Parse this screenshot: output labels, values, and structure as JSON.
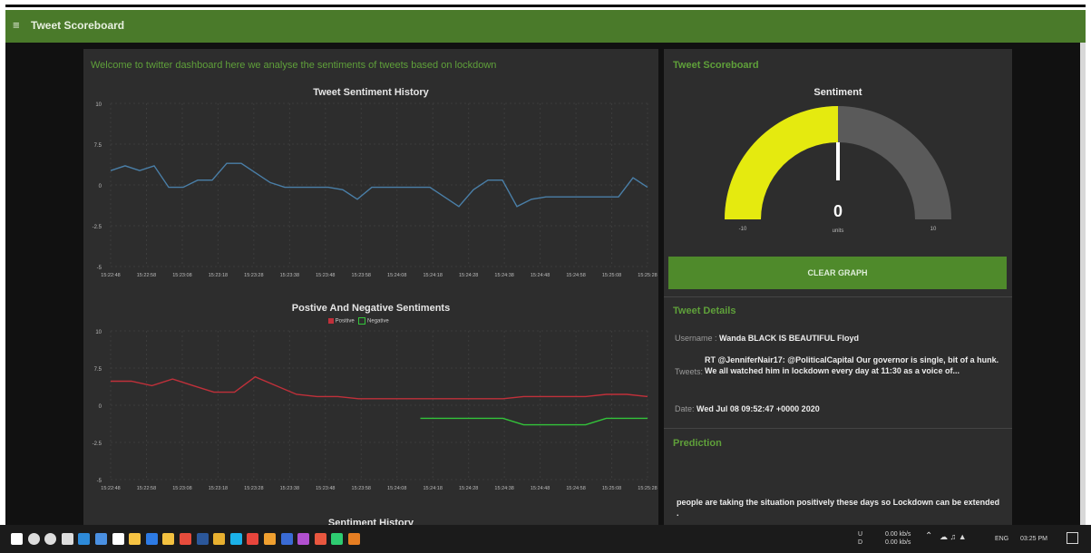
{
  "header": {
    "title": "Tweet Scoreboard",
    "menu_icon": "hamburger-icon"
  },
  "colors": {
    "accent": "#5fa03a",
    "header": "#4a7a2a",
    "button": "#4f8a2b",
    "gauge_fill": "#e5ea0f",
    "gauge_bg": "#5a5a5a",
    "history_line": "#4a7fa8",
    "positive": "#c0303a",
    "negative": "#33c43a"
  },
  "welcome": "Welcome to twitter dashboard here we analyse the sentiments of tweets based on lockdown",
  "history_chart": {
    "type": "line",
    "title": "Tweet Sentiment History",
    "y_ticks": [
      "10",
      "7.5",
      "0",
      "-2.5",
      "-5"
    ],
    "x_ticks": [
      "15:22:48",
      "15:22:58",
      "15:23:08",
      "15:23:18",
      "15:23:28",
      "15:23:38",
      "15:23:48",
      "15:23:58",
      "15:24:08",
      "15:24:18",
      "15:24:28",
      "15:24:38",
      "15:24:48",
      "15:24:58",
      "15:25:08",
      "15:25:28"
    ]
  },
  "posneg_chart": {
    "type": "line",
    "title": "Postive And Negative Sentiments",
    "legend": {
      "positive": "Positive",
      "negative": "Negative"
    },
    "y_ticks": [
      "10",
      "7.5",
      "0",
      "-2.5",
      "-5"
    ],
    "x_ticks": [
      "15:22:48",
      "15:22:58",
      "15:23:08",
      "15:23:18",
      "15:23:28",
      "15:23:38",
      "15:23:48",
      "15:23:58",
      "15:24:08",
      "15:24:18",
      "15:24:28",
      "15:24:38",
      "15:24:48",
      "15:24:58",
      "15:25:08",
      "15:25:28"
    ]
  },
  "history_title_3": "Sentiment History",
  "chart_data": [
    {
      "type": "line",
      "title": "Tweet Sentiment History",
      "ylim": [
        -5,
        10
      ],
      "x": [
        "15:22:48",
        "15:22:52",
        "15:22:56",
        "15:23:00",
        "15:23:04",
        "15:23:08",
        "15:23:12",
        "15:23:16",
        "15:23:20",
        "15:23:24",
        "15:23:28",
        "15:23:32",
        "15:23:36",
        "15:23:40",
        "15:23:44",
        "15:23:48",
        "15:23:52",
        "15:23:56",
        "15:24:00",
        "15:24:04",
        "15:24:08",
        "15:24:12",
        "15:24:16",
        "15:24:20",
        "15:24:24",
        "15:24:28",
        "15:24:32",
        "15:24:36",
        "15:24:40",
        "15:24:44",
        "15:24:48",
        "15:24:52",
        "15:24:56",
        "15:25:00",
        "15:25:04",
        "15:25:08",
        "15:25:16",
        "15:25:28"
      ],
      "series": [
        {
          "values": [
            0.6,
            0.8,
            0.6,
            0.8,
            -0.1,
            -0.1,
            0.2,
            0.2,
            0.9,
            0.9,
            0.5,
            0.1,
            -0.1,
            -0.1,
            -0.1,
            -0.1,
            -0.2,
            -0.6,
            -0.1,
            -0.1,
            -0.1,
            -0.1,
            -0.1,
            -0.5,
            -0.9,
            -0.2,
            0.2,
            0.2,
            -0.9,
            -0.6,
            -0.5,
            -0.5,
            -0.5,
            -0.5,
            -0.5,
            -0.5,
            0.3,
            -0.1
          ]
        }
      ]
    },
    {
      "type": "line",
      "title": "Postive And Negative Sentiments",
      "ylim": [
        -5,
        10
      ],
      "x": [
        "15:22:48",
        "15:22:54",
        "15:23:00",
        "15:23:06",
        "15:23:12",
        "15:23:18",
        "15:23:24",
        "15:23:30",
        "15:23:36",
        "15:23:42",
        "15:23:48",
        "15:23:54",
        "15:24:00",
        "15:24:06",
        "15:24:12",
        "15:24:18",
        "15:24:24",
        "15:24:30",
        "15:24:36",
        "15:24:42",
        "15:24:48",
        "15:24:54",
        "15:25:00",
        "15:25:06",
        "15:25:12",
        "15:25:18",
        "15:25:24"
      ],
      "series": [
        {
          "name": "Positive",
          "values": [
            1.1,
            1.1,
            0.9,
            1.2,
            0.9,
            0.6,
            0.6,
            1.3,
            0.9,
            0.5,
            0.4,
            0.4,
            0.3,
            0.3,
            0.3,
            0.3,
            0.3,
            0.3,
            0.3,
            0.3,
            0.4,
            0.4,
            0.4,
            0.4,
            0.5,
            0.5,
            0.4
          ]
        },
        {
          "name": "Negative",
          "values": [
            null,
            null,
            null,
            null,
            null,
            null,
            null,
            null,
            null,
            null,
            null,
            null,
            null,
            null,
            null,
            -0.6,
            -0.6,
            -0.6,
            -0.6,
            -0.6,
            -0.9,
            -0.9,
            -0.9,
            -0.9,
            -0.6,
            -0.6,
            -0.6
          ]
        }
      ]
    }
  ],
  "scoreboard": {
    "title": "Tweet Scoreboard",
    "gauge": {
      "title": "Sentiment",
      "value": "0",
      "units": "units",
      "min_label": "-10",
      "max_label": "10",
      "min": -10,
      "max": 10,
      "current": 0
    },
    "clear_button": "CLEAR GRAPH"
  },
  "details": {
    "title": "Tweet Details",
    "username_label": "Username :",
    "username_value": "Wanda BLACK IS BEAUTIFUL Floyd",
    "tweets_label": "Tweets:",
    "tweets_value": "RT @JenniferNair17: @PoliticalCapital Our governor is single, bit of a hunk. We all watched him in lockdown every day at 11:30 as a voice of...",
    "date_label": "Date:",
    "date_value": "Wed Jul 08 09:52:47 +0000 2020"
  },
  "prediction": {
    "title": "Prediction",
    "text": "people are taking the situation positively these days so Lockdown can be extended ."
  },
  "taskbar": {
    "icons": [
      "windows-start-icon",
      "search-icon",
      "cortana-icon",
      "task-view-icon",
      "edge-icon",
      "mail-icon",
      "store-icon",
      "file-icon",
      "outlook-icon",
      "folder-icon",
      "settings-icon",
      "word-icon",
      "chrome-icon",
      "app-icon",
      "app-icon",
      "app-icon",
      "app-icon",
      "app-icon",
      "app-icon",
      "app-icon",
      "vlc-icon"
    ],
    "net_up": "0.00 kb/s",
    "net_down": "0.00 kb/s",
    "lang": "ENG",
    "time": "03:25 PM"
  }
}
